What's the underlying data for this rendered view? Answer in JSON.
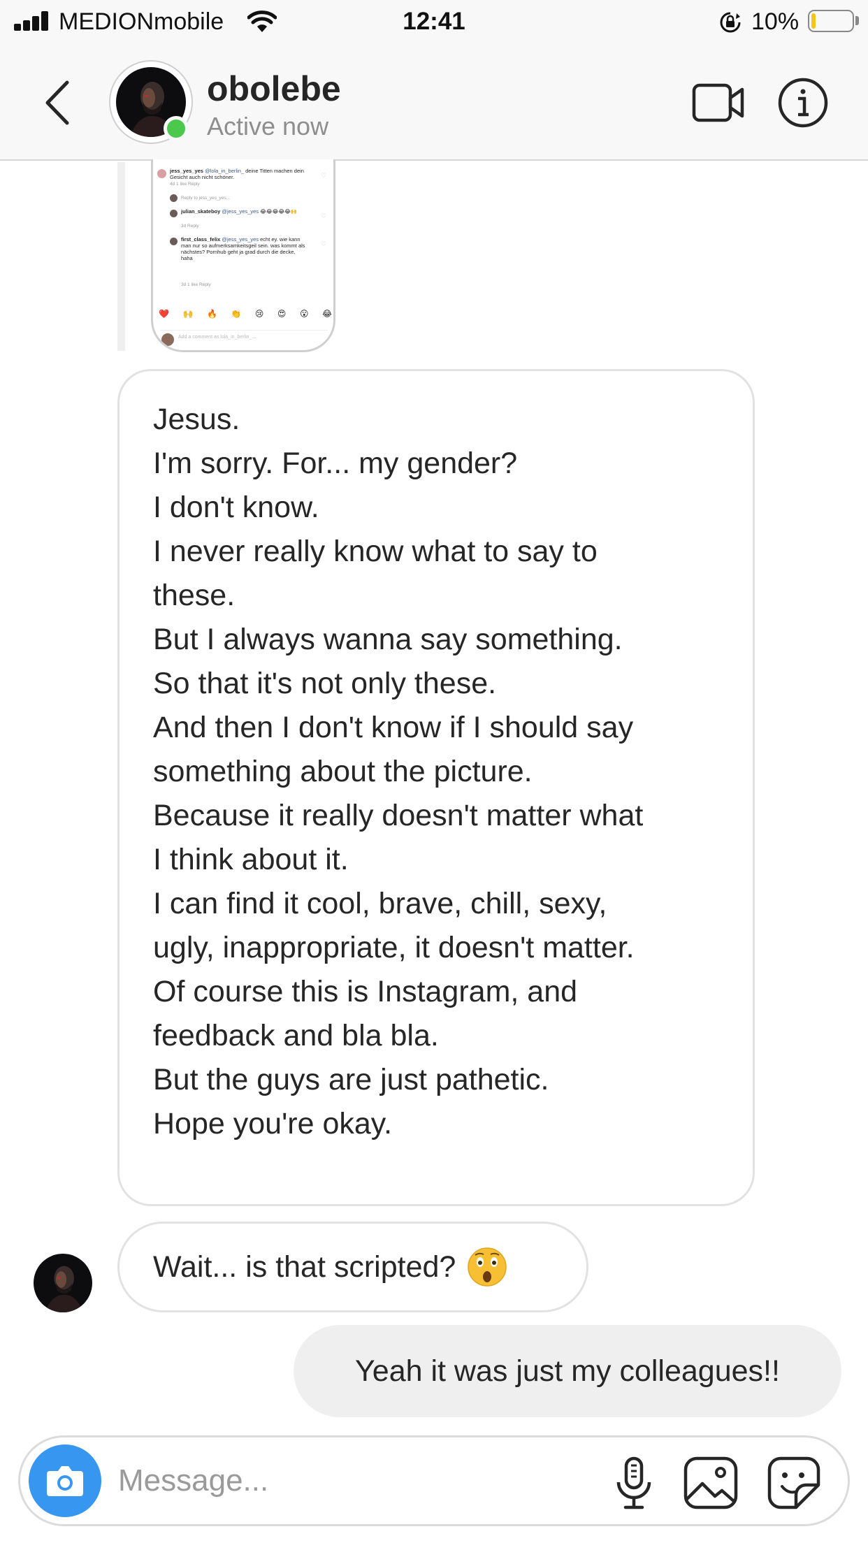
{
  "status_bar": {
    "carrier": "MEDIONmobile",
    "time": "12:41",
    "battery_percent": "10%",
    "battery_level": 0.1,
    "icons": [
      "signal-icon",
      "wifi-icon",
      "rotation-lock-icon",
      "battery-icon"
    ]
  },
  "header": {
    "username": "obolebe",
    "status": "Active now",
    "icons": [
      "back-chevron-icon",
      "video-call-icon",
      "info-icon"
    ],
    "active_color": "#4cc94c"
  },
  "shared_post": {
    "comments": [
      {
        "user": "jess_yes_yes",
        "mention": "@lola_in_berlin_",
        "text": "deine Titten machen dein Gesicht auch nicht schöner.",
        "meta": "4d   1 like   Reply"
      },
      {
        "reply_hint": "Reply to jess_yes_yes..."
      },
      {
        "user": "julian_skateboy",
        "mention": "@jess_yes_yes",
        "text": "😂😂😂😂😂🙌",
        "meta": "3d   Reply"
      },
      {
        "user": "first_class_felix",
        "mention": "@jess_yes_yes",
        "text": "echt ey. wie kann man nur so aufmerksamkeitsgeil sein. was kommt als nächstes? Pornhub geht ja grad durch die decke, haha",
        "meta": "3d   1 like   Reply"
      }
    ],
    "quick_reactions": [
      "❤️",
      "🙌",
      "🔥",
      "👏",
      "😢",
      "😍",
      "😮",
      "😂"
    ],
    "comment_placeholder": "Add a comment as lola_in_berlin_..."
  },
  "messages": {
    "long_message_lines": [
      "Jesus.",
      "I'm sorry. For... my gender?",
      "I don't know.",
      "I never really know what to say to",
      "these.",
      "But I always wanna say something.",
      "So that it's not only these.",
      "And then I don't know if I should say",
      "something about the picture.",
      "Because it really doesn't matter what",
      "I think about it.",
      "I can find it cool, brave, chill, sexy,",
      "ugly, inappropriate, it doesn't matter.",
      "Of course this is Instagram, and",
      "feedback and bla bla.",
      "But the guys are just pathetic.",
      "Hope you're okay."
    ],
    "reply_text": "Wait... is that scripted?",
    "reply_emoji": "astonished-face-icon",
    "my_reply": "Yeah it was just my colleagues!!"
  },
  "composer": {
    "placeholder": "Message...",
    "value": "",
    "accent": "#3797f0",
    "icons": [
      "camera-icon",
      "microphone-icon",
      "gallery-icon",
      "sticker-icon"
    ]
  }
}
